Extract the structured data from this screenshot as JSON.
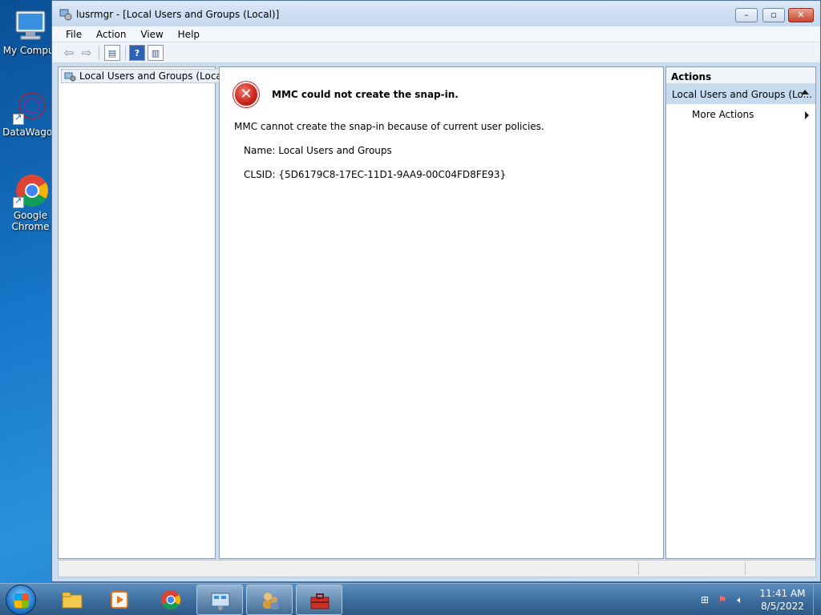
{
  "desktop": {
    "icons": [
      {
        "label": "My Comput",
        "icon": "computer-icon"
      },
      {
        "label": "DataWagon",
        "icon": "datawagon-icon"
      },
      {
        "label": "Google Chrome",
        "icon": "chrome-icon"
      }
    ]
  },
  "window": {
    "title": "lusrmgr - [Local Users and Groups (Local)]",
    "controls": {
      "minimize": "–",
      "maximize": "▫",
      "close": "✕"
    }
  },
  "menu": [
    "File",
    "Action",
    "View",
    "Help"
  ],
  "toolbar": {
    "icons": [
      "back-arrow-icon",
      "forward-arrow-icon",
      "show-hide-console-tree-icon",
      "help-icon",
      "show-hide-action-pane-icon"
    ]
  },
  "tree": {
    "selected_item": "Local Users and Groups (Local)"
  },
  "content": {
    "error_title": "MMC could not create the snap-in.",
    "message": "MMC cannot create the snap-in because of current user policies.",
    "name_line": "Name: Local Users and Groups",
    "clsid_line": "CLSID: {5D6179C8-17EC-11D1-9AA9-00C04FD8FE93}"
  },
  "actions_pane": {
    "header": "Actions",
    "group": "Local Users and Groups (Lo...",
    "items": [
      "More Actions"
    ]
  },
  "taskbar": {
    "pinned": [
      "explorer-icon",
      "media-player-icon",
      "chrome-icon",
      "network-adapter-icon",
      "users-icon",
      "toolbox-icon"
    ],
    "tray": {
      "time": "11:41 AM",
      "date": "8/5/2022"
    }
  },
  "colors": {
    "accent": "#c7dbef",
    "error": "#c8231a",
    "taskbar": "#3f6f9f"
  }
}
